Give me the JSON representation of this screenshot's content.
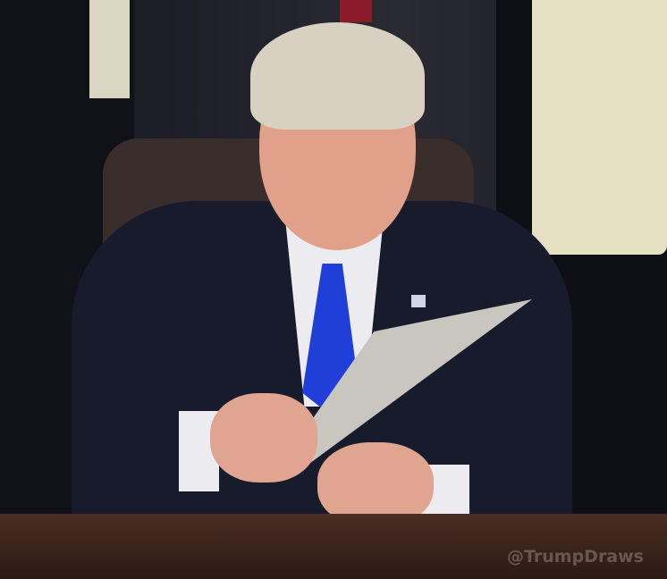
{
  "watermark": {
    "text": "@TrumpDraws"
  }
}
